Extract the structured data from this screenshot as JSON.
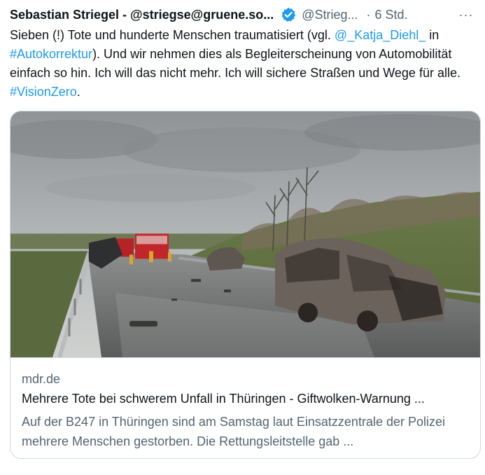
{
  "tweet": {
    "author_name": "Sebastian Striegel - @striegse@gruene.so...",
    "handle": "@Strieg...",
    "separator": "·",
    "time": "6 Std.",
    "more_label": "···",
    "verified_icon": "verified-badge-icon",
    "text_segments": [
      {
        "text": "Sieben (!) Tote und hunderte Menschen traumatisiert (vgl. ",
        "link": false
      },
      {
        "text": "@_Katja_Diehl_",
        "link": true
      },
      {
        "text": " in ",
        "link": false
      },
      {
        "text": "#Autokorrektur",
        "link": true
      },
      {
        "text": "). Und wir nehmen dies als Begleiterscheinung von Automobilität einfach so hin. Ich will das nicht mehr. Ich will sichere Straßen und Wege für alle. ",
        "link": false
      },
      {
        "text": "#VisionZero",
        "link": true
      },
      {
        "text": ".",
        "link": false
      }
    ]
  },
  "card": {
    "domain": "mdr.de",
    "title": "Mehrere Tote bei schwerem Unfall in Thüringen - Giftwolken-Warnung ...",
    "description": "Auf der B247 in Thüringen sind am Samstag laut Einsatzzentrale der Polizei mehrere Menschen gestorben. Die Rettungsleitstelle gab ..."
  },
  "colors": {
    "accent": "#1d9bf0",
    "text_primary": "#0f1419",
    "text_secondary": "#536471",
    "border": "#cfd9de"
  }
}
